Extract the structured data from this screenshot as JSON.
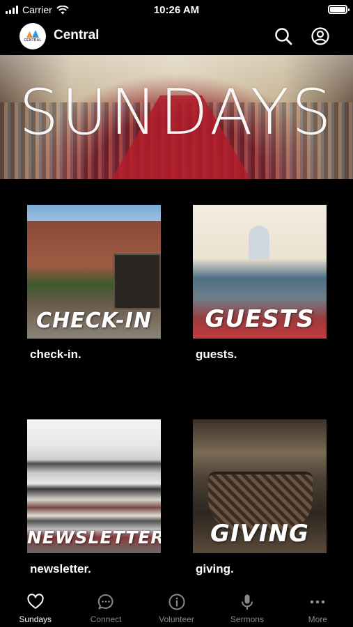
{
  "status_bar": {
    "carrier": "Carrier",
    "time": "10:26 AM"
  },
  "header": {
    "title": "Central",
    "logo_text": "CENTRAL"
  },
  "hero": {
    "title": "SUNDAYS"
  },
  "tiles": [
    {
      "overlay": "CHECK-IN",
      "caption": "check-in."
    },
    {
      "overlay": "GUESTS",
      "caption": "guests."
    },
    {
      "overlay": "NEWSLETTER",
      "caption": "newsletter."
    },
    {
      "overlay": "GIVING",
      "caption": "giving."
    }
  ],
  "tab_bar": {
    "items": [
      {
        "label": "Sundays",
        "icon": "heart-icon",
        "active": true
      },
      {
        "label": "Connect",
        "icon": "chat-bubble-icon",
        "active": false
      },
      {
        "label": "Volunteer",
        "icon": "info-icon",
        "active": false
      },
      {
        "label": "Sermons",
        "icon": "microphone-icon",
        "active": false
      },
      {
        "label": "More",
        "icon": "ellipsis-icon",
        "active": false
      }
    ]
  },
  "colors": {
    "background": "#000000",
    "text": "#ffffff",
    "tab_inactive": "#8a8a8a"
  }
}
